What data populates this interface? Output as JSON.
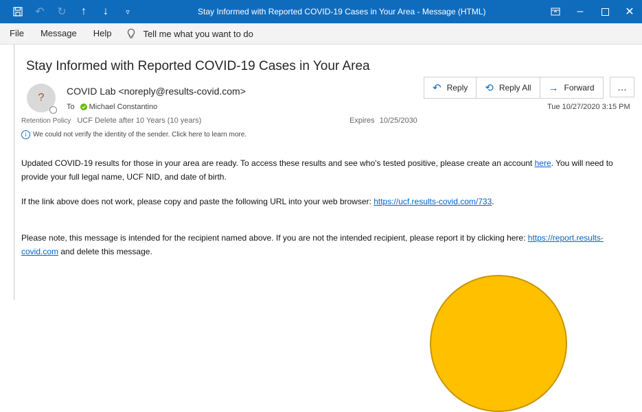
{
  "window": {
    "title": "Stay Informed with Reported COVID-19 Cases in Your Area  -  Message (HTML)"
  },
  "menu": {
    "file": "File",
    "message": "Message",
    "help": "Help",
    "tell_me": "Tell me what you want to do"
  },
  "email": {
    "subject": "Stay Informed with Reported COVID-19 Cases in Your Area",
    "avatar_initial": "?",
    "sender": "COVID Lab <noreply@results-covid.com>",
    "to_label": "To",
    "recipient": "Michael Constantino",
    "retention_label": "Retention Policy",
    "retention_value": "UCF Delete after 10 Years (10 years)",
    "expires_label": "Expires",
    "expires_value": "10/25/2030",
    "warning": "We could not verify the identity of the sender. Click here to learn more.",
    "datetime": "Tue 10/27/2020 3:15 PM"
  },
  "actions": {
    "reply": "Reply",
    "reply_all": "Reply All",
    "forward": "Forward",
    "more": "…"
  },
  "body": {
    "p1_before_link": "Updated COVID-19 results for those in your area are ready.  To access these results and see who's tested positive, please create an account ",
    "p1_link": "here",
    "p1_after_link": ". You will need to provide your full legal name, UCF NID, and date of birth.",
    "p2_before_link": "If the link above does not work, please copy and paste the following URL into your web browser:  ",
    "p2_link": "https://ucf.results-covid.com/733",
    "p2_after_link": ".",
    "p3_before_link": "Please note, this message is intended for the recipient named above.  If you are not the intended recipient, please report it by clicking here:  ",
    "p3_link": "https://report.results-covid.com",
    "p3_after_link": " and delete this message."
  },
  "colors": {
    "titlebar": "#0f6cbd",
    "link": "#0563c1",
    "presence": "#6bb700",
    "highlight_circle": "#ffc000"
  }
}
